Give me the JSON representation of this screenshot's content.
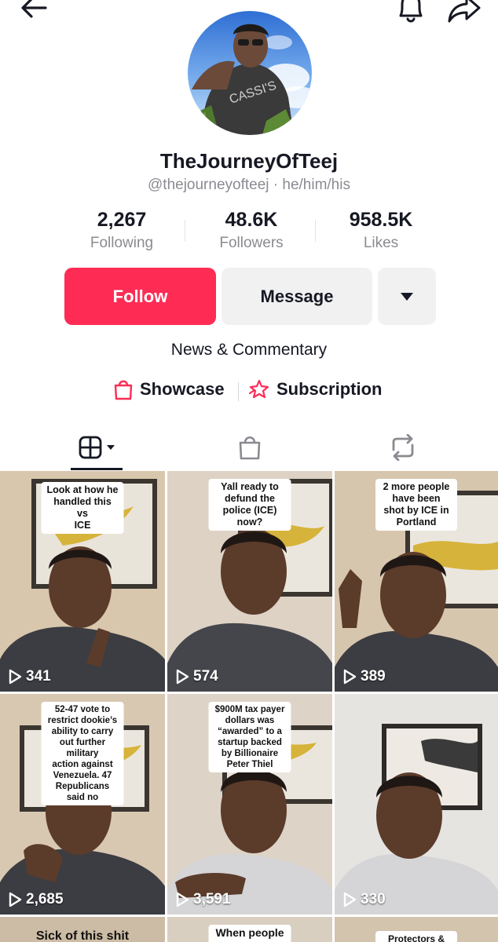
{
  "profile": {
    "display_name": "TheJourneyOfTeej",
    "handle": "@thejourneyofteej · he/him/his",
    "category": "News & Commentary"
  },
  "stats": [
    {
      "value": "2,267",
      "label": "Following"
    },
    {
      "value": "48.6K",
      "label": "Followers"
    },
    {
      "value": "958.5K",
      "label": "Likes"
    }
  ],
  "actions": {
    "follow_label": "Follow",
    "message_label": "Message"
  },
  "links": {
    "showcase_label": "Showcase",
    "subscription_label": "Subscription"
  },
  "icons": {
    "back": "arrow-left-icon",
    "bell": "bell-icon",
    "share": "share-icon",
    "more": "triangle-down-icon",
    "tab_videos": "grid-icon",
    "tab_shop": "shopping-bag-icon",
    "tab_reposts": "repost-icon"
  },
  "colors": {
    "accent": "#fe2c55",
    "text": "#161823",
    "muted": "#8a8b91",
    "button_bg": "#f1f1f2"
  },
  "videos": [
    {
      "caption": "Look at how he handled this\nvs\nICE",
      "views": "341"
    },
    {
      "caption": "Yall ready to defund the\npolice (ICE) now?",
      "views": "574"
    },
    {
      "caption": "2 more people have been\nshot by ICE in Portland",
      "views": "389"
    },
    {
      "caption": "52-47 vote to restrict dookie’s\nability to carry out further military\naction against Venezuela. 47\nRepublicans said no",
      "views": "2,685"
    },
    {
      "caption": "$900M tax payer dollars was\n“awarded” to a startup backed\nby Billionaire Peter Thiel",
      "views": "3,591"
    },
    {
      "caption": "",
      "views": "330"
    },
    {
      "caption": "Sick of this shit",
      "views": ""
    },
    {
      "caption": "When people say",
      "views": ""
    },
    {
      "caption": "Protectors & Providers",
      "views": ""
    }
  ]
}
